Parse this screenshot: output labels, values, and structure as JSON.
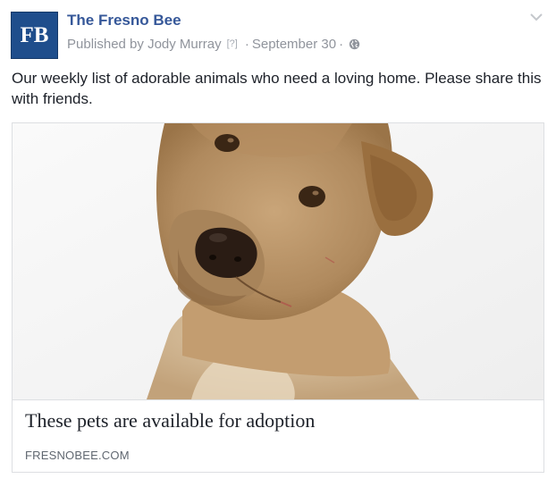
{
  "post": {
    "page_logo": "FB",
    "page_name": "The Fresno Bee",
    "published_by_prefix": "Published by",
    "author": "Jody Murray",
    "help_marker": "[?]",
    "separator": "·",
    "date": "September 30",
    "audience_icon": "globe-icon",
    "menu_icon": "chevron-down-icon",
    "message": "Our weekly list of adorable animals who need a loving home. Please share this with friends."
  },
  "link_card": {
    "image_subject": "dog",
    "title": "These pets are available for adoption",
    "domain": "FRESNOBEE.COM"
  },
  "colors": {
    "brand_blue": "#365899",
    "logo_blue": "#1f4e8c",
    "meta_gray": "#90949c",
    "border": "#dddfe2"
  }
}
